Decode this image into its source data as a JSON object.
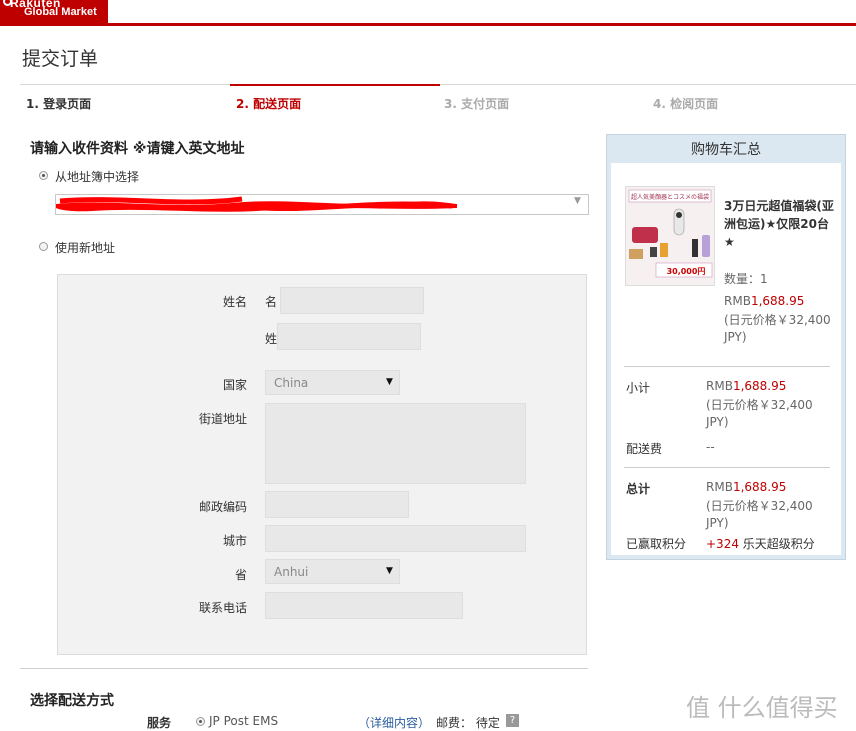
{
  "header": {
    "logo_line1": "Rakuten",
    "logo_line2": "Global Market",
    "brand_color": "#bf0000"
  },
  "page_title": "提交订单",
  "steps": [
    {
      "label": "1. 登录页面",
      "state": "done"
    },
    {
      "label": "2. 配送页面",
      "state": "active"
    },
    {
      "label": "3. 支付页面",
      "state": "pending"
    },
    {
      "label": "4. 检阅页面",
      "state": "pending"
    }
  ],
  "address": {
    "section_title": "请输入收件资料 ※请键入英文地址",
    "option_book": "从地址簿中选择",
    "option_new": "使用新地址",
    "selected": "book"
  },
  "form": {
    "name_label": "姓名",
    "first_name_label": "名",
    "last_name_label": "姓",
    "country_label": "国家",
    "country_value": "China",
    "street_label": "街道地址",
    "zip_label": "邮政编码",
    "city_label": "城市",
    "province_label": "省",
    "province_value": "Anhui",
    "phone_label": "联系电话"
  },
  "shipping": {
    "title": "选择配送方式",
    "service_label": "服务",
    "option": "JP Post EMS",
    "detail_link": "（详细内容）",
    "fee_text": "邮费： 待定",
    "help_icon": "?"
  },
  "cart": {
    "title": "购物车汇总",
    "product": {
      "image_title_text": "超人気美顔器とコスメの福袋",
      "image_price": "30,000円",
      "name": "3万日元超值福袋(亚洲包运)★仅限20台★",
      "qty_text": "数量：1",
      "price_prefix": "RMB",
      "price_value": "1,688.95",
      "jpy_text": "(日元价格￥32,400 JPY)"
    },
    "subtotal": {
      "label": "小计",
      "prefix": "RMB",
      "value": "1,688.95",
      "jpy": "(日元价格￥32,400 JPY)"
    },
    "shipping_fee": {
      "label": "配送费",
      "value": "--"
    },
    "total": {
      "label": "总计",
      "prefix": "RMB",
      "value": "1,688.95",
      "jpy": "(日元价格￥32,400 JPY)"
    },
    "points": {
      "label": "已赢取积分",
      "value": "+324",
      "suffix": " 乐天超级积分"
    }
  },
  "watermark": "值 什么值得买"
}
